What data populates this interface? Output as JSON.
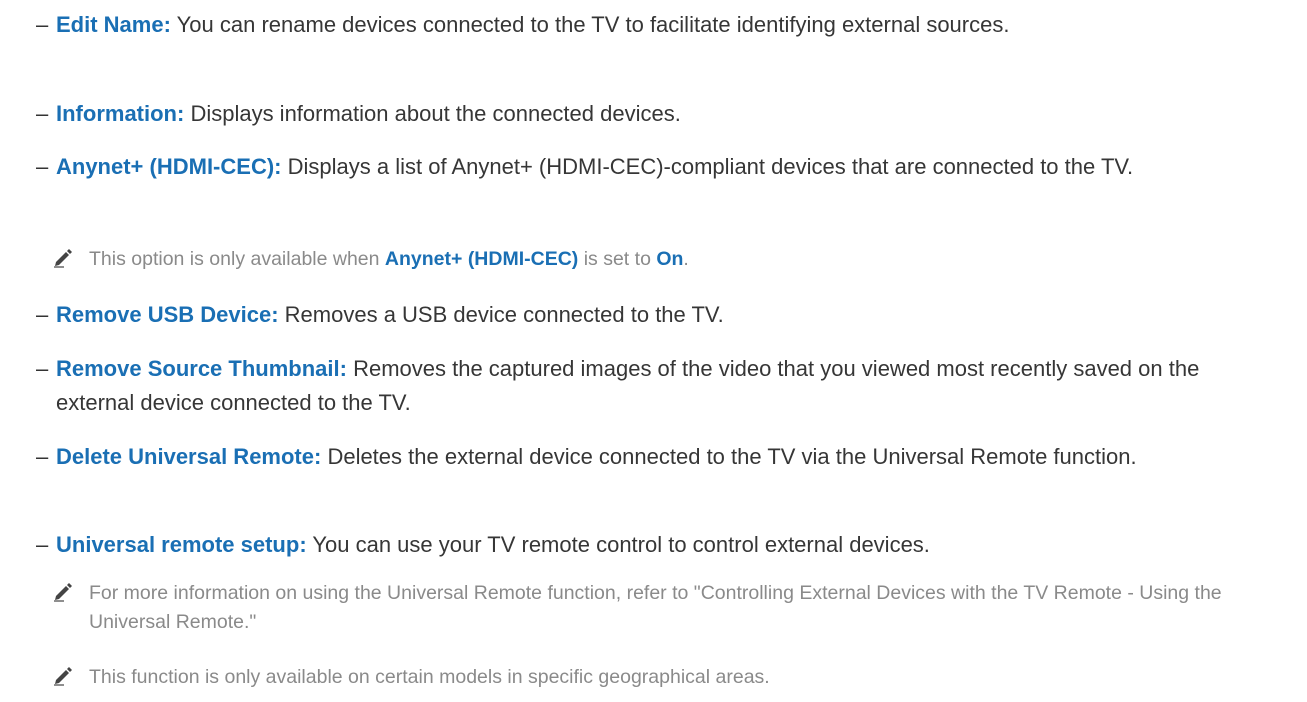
{
  "items": [
    {
      "dash": "–",
      "term": "Edit Name",
      "sep": ":",
      "desc": " You can rename devices connected to the TV to facilitate identifying external sources."
    },
    {
      "dash": "–",
      "term": "Information",
      "sep": ":",
      "desc": " Displays information about the connected devices."
    },
    {
      "dash": "–",
      "term": "Anynet+ (HDMI-CEC)",
      "sep": ":",
      "desc": " Displays a list of Anynet+ (HDMI-CEC)-compliant devices that are connected to the TV."
    },
    {
      "dash": "–",
      "term": "Remove USB Device",
      "sep": ":",
      "desc": " Removes a USB device connected to the TV."
    },
    {
      "dash": "–",
      "term": "Remove Source Thumbnail",
      "sep": ":",
      "desc": " Removes the captured images of the video that you viewed most recently saved on the external device connected to the TV."
    },
    {
      "dash": "–",
      "term": "Delete Universal Remote",
      "sep": ":",
      "desc": " Deletes the external device connected to the TV via the Universal Remote function."
    },
    {
      "dash": "–",
      "term": "Universal remote setup",
      "sep": ":",
      "desc": " You can use your TV remote control to control external devices."
    }
  ],
  "notes": {
    "anynet": {
      "icon": "pencil-icon",
      "pre": "This option is only available when ",
      "term1": "Anynet+ (HDMI-CEC)",
      "mid": " is set to ",
      "term2": "On",
      "post": "."
    },
    "universal_info": {
      "icon": "pencil-icon",
      "text": "For more information on using the Universal Remote function, refer to \"Controlling External Devices with the TV Remote - Using the Universal Remote.\""
    },
    "availability": {
      "icon": "pencil-icon",
      "text": "This function is only available on certain models in specific geographical areas."
    }
  },
  "colors": {
    "term": "#1a6fb4",
    "body_text": "#363636",
    "note_text": "#8a8a8a"
  }
}
